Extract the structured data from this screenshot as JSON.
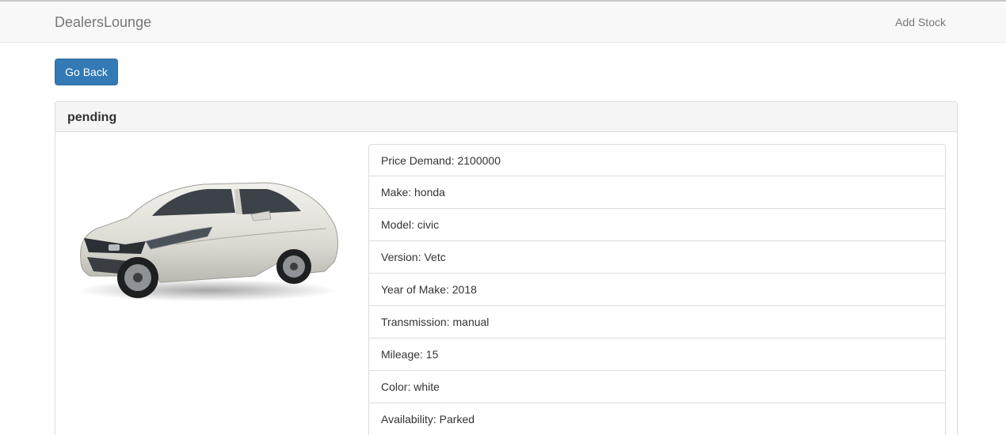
{
  "navbar": {
    "brand": "DealersLounge",
    "add_stock": "Add Stock"
  },
  "actions": {
    "go_back": "Go Back"
  },
  "panel": {
    "title": "pending",
    "car_image_icon": "honda-civic-sedan-image",
    "details": [
      "Price Demand: 2100000",
      "Make: honda",
      "Model: civic",
      "Version: Vetc",
      "Year of Make: 2018",
      "Transmission: manual",
      "Mileage: 15",
      "Color: white",
      "Availability: Parked"
    ]
  },
  "colors": {
    "primary": "#337ab7",
    "navbar_bg": "#f8f8f8",
    "panel_heading_bg": "#f5f5f5"
  }
}
